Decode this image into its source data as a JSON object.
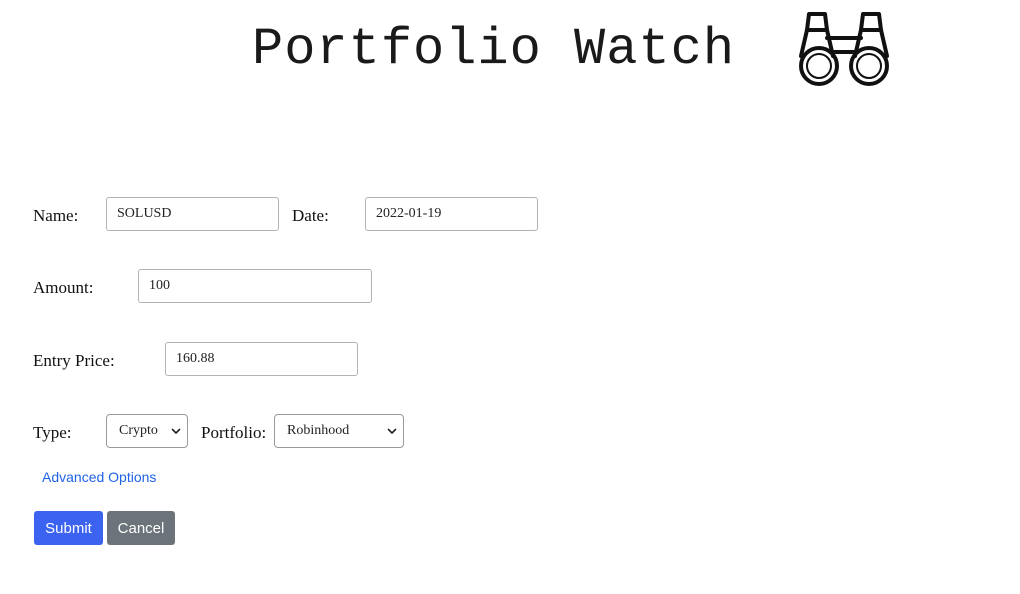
{
  "header": {
    "title": "Portfolio Watch",
    "icon": "binoculars-icon"
  },
  "form": {
    "name": {
      "label": "Name:",
      "value": "SOLUSD"
    },
    "date": {
      "label": "Date:",
      "value": "2022-01-19"
    },
    "amount": {
      "label": "Amount:",
      "value": "100"
    },
    "entry_price": {
      "label": "Entry Price:",
      "value": "160.88"
    },
    "type": {
      "label": "Type:",
      "selected": "Crypto"
    },
    "portfolio": {
      "label": "Portfolio:",
      "selected": "Robinhood"
    },
    "advanced_options": "Advanced Options",
    "submit_label": "Submit",
    "cancel_label": "Cancel"
  },
  "colors": {
    "primary": "#3b63f0",
    "secondary": "#6c737b",
    "link": "#1f63e6"
  }
}
